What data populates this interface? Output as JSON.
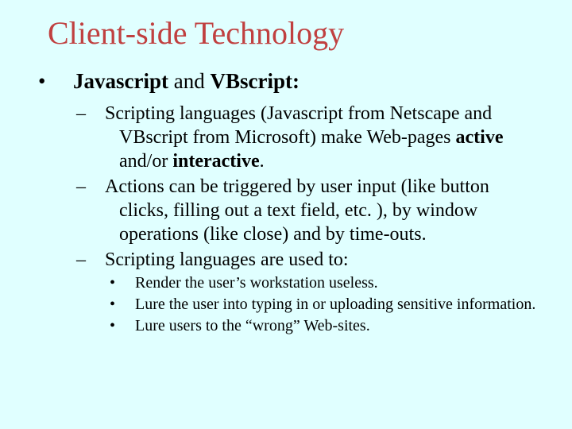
{
  "title": "Client-side Technology",
  "lvl1": {
    "bullet": "•",
    "t1": "Javascript",
    "t2": " and ",
    "t3": "VBscript:"
  },
  "sub": {
    "dash": "–",
    "s1a": "Scripting languages (Javascript from Netscape and VBscript from Microsoft) make Web-pages ",
    "s1b": "active",
    "s1c": " and/or ",
    "s1d": "interactive",
    "s1e": ".",
    "s2": "Actions can be triggered by user input (like button clicks, filling out a text field, etc. ), by window operations (like close) and by time-outs.",
    "s3": "Scripting languages are used to:"
  },
  "sub2": {
    "dot": "•",
    "i1": "Render the user’s workstation useless.",
    "i2": "Lure the user into typing in or uploading sensitive information.",
    "i3": "Lure users to the “wrong” Web-sites."
  }
}
